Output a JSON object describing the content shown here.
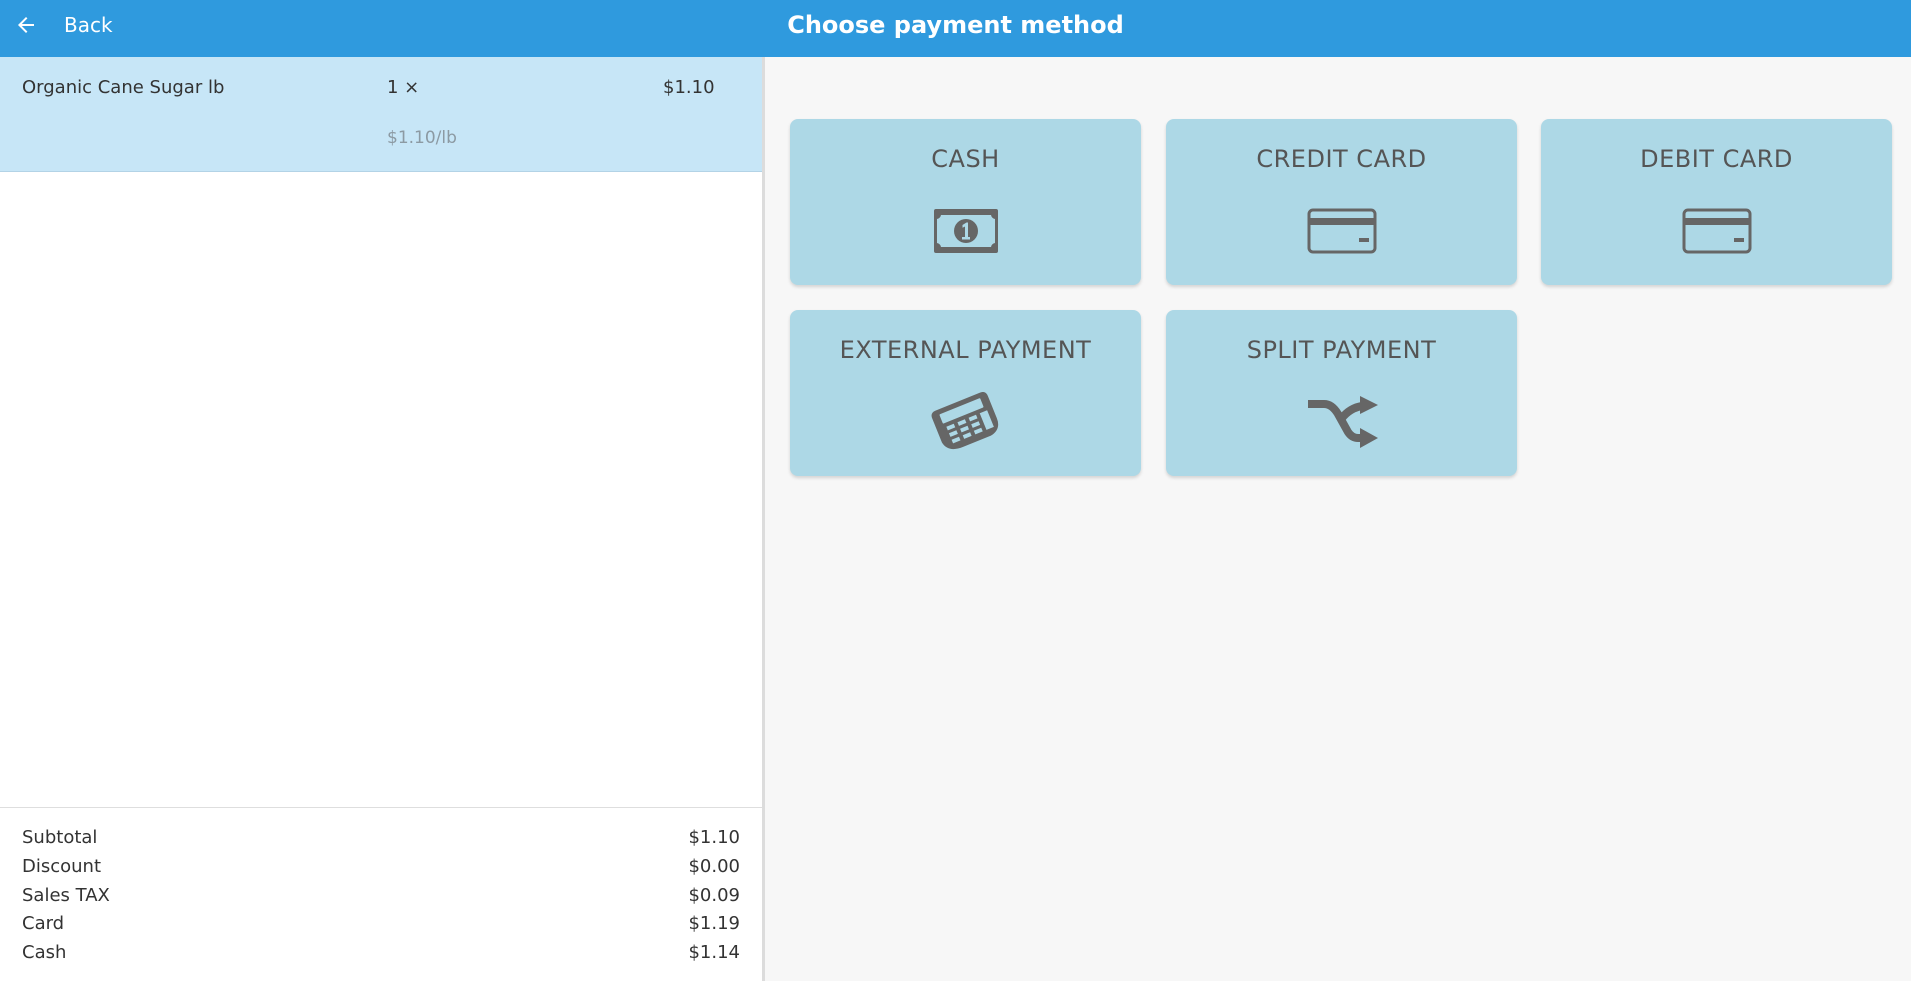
{
  "header": {
    "back_label": "Back",
    "title": "Choose payment method"
  },
  "order": {
    "lines": [
      {
        "name": "Organic Cane Sugar lb",
        "qty": "1 ×",
        "price": "$1.10",
        "unit_price": "$1.10/lb"
      }
    ]
  },
  "totals": {
    "subtotal": {
      "label": "Subtotal",
      "value": "$1.10"
    },
    "discount": {
      "label": "Discount",
      "value": "$0.00"
    },
    "tax": {
      "label": "Sales TAX",
      "value": "$0.09"
    },
    "card": {
      "label": "Card",
      "value": "$1.19"
    },
    "cash": {
      "label": "Cash",
      "value": "$1.14"
    }
  },
  "payment_methods": [
    {
      "label": "CASH",
      "icon": "cash-bill-icon"
    },
    {
      "label": "CREDIT CARD",
      "icon": "credit-card-icon"
    },
    {
      "label": "DEBIT CARD",
      "icon": "credit-card-icon"
    },
    {
      "label": "EXTERNAL PAYMENT",
      "icon": "card-terminal-icon"
    },
    {
      "label": "SPLIT PAYMENT",
      "icon": "split-arrows-icon"
    }
  ],
  "colors": {
    "header": "#2f9ade",
    "tile": "#add8e6",
    "selected_line": "#c7e6f7",
    "icon": "#666666"
  }
}
